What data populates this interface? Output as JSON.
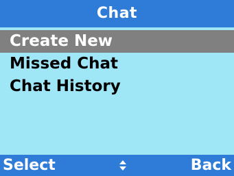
{
  "title": "Chat",
  "menu": {
    "items": [
      {
        "label": "Create New",
        "selected": true
      },
      {
        "label": "Missed Chat",
        "selected": false
      },
      {
        "label": "Chat History",
        "selected": false
      }
    ]
  },
  "softkeys": {
    "left": "Select",
    "center_icon": "up-down-navigation-icon",
    "right": "Back"
  },
  "colors": {
    "bar": "#2e7bd8",
    "background": "#9fe6f7",
    "selection": "#808080"
  }
}
